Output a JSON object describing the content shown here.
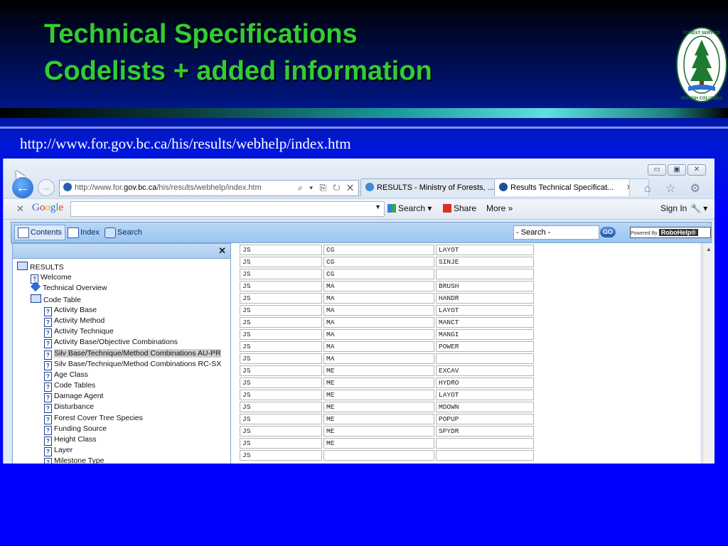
{
  "slide": {
    "title_line1": "Technical Specifications",
    "title_line2": "Codelists + added information",
    "url_caption": "http://www.for.gov.bc.ca/his/results/webhelp/index.htm",
    "logo_text_top": "FOREST SERVICE",
    "logo_text_bottom": "BRITISH COLUMBIA"
  },
  "browser": {
    "address_prefix": "http://www.for.",
    "address_domain": "gov.bc.ca",
    "address_suffix": "/his/results/webhelp/index.htm",
    "address_tools": "⌕ ▾ ⎘ ↻ ✕",
    "tabs": [
      {
        "label": "RESULTS - Ministry of Forests, ..."
      },
      {
        "label": "Results Technical Specificat...",
        "close": "✕"
      }
    ],
    "window_buttons": [
      "▭",
      "▣",
      "✕"
    ],
    "toolbar_icons": "⌂ ☆ ⚙",
    "back_glyph": "←",
    "forward_glyph": "→"
  },
  "google_bar": {
    "close": "✕",
    "logo": [
      "G",
      "o",
      "o",
      "g",
      "l",
      "e"
    ],
    "dropdown_glyph": "▼",
    "search_label": "Search ▾",
    "share_label": "Share",
    "more_label": "More »",
    "signin_label": "Sign In",
    "wrench_glyph": "🔧 ▾"
  },
  "robohelp": {
    "tab_contents": "Contents",
    "tab_index": "Index",
    "tab_search": "Search",
    "search_placeholder": "- Search -",
    "go_label": "GO",
    "powered_prefix": "Powered By",
    "powered_brand": "RoboHelp®",
    "toc_close": "✕",
    "toc": [
      {
        "label": "RESULTS",
        "type": "book",
        "indent": 0
      },
      {
        "label": "Welcome",
        "type": "topic",
        "indent": 1
      },
      {
        "label": "Technical Overview",
        "type": "diamond",
        "indent": 1
      },
      {
        "label": "Code Table",
        "type": "book",
        "indent": 1
      },
      {
        "label": "Activity Base",
        "type": "topic",
        "indent": 2
      },
      {
        "label": "Activity Method",
        "type": "topic",
        "indent": 2
      },
      {
        "label": "Activity Technique",
        "type": "topic",
        "indent": 2
      },
      {
        "label": "Activity Base/Objective Combinations",
        "type": "topic",
        "indent": 2
      },
      {
        "label": "Silv Base/Technique/Method Combinations AU-PR",
        "type": "topic",
        "indent": 2,
        "selected": true
      },
      {
        "label": "Silv Base/Technique/Method Combinations RC-SX",
        "type": "topic",
        "indent": 2
      },
      {
        "label": "Age Class",
        "type": "topic",
        "indent": 2
      },
      {
        "label": "Code Tables",
        "type": "topic",
        "indent": 2
      },
      {
        "label": "Damage Agent",
        "type": "topic",
        "indent": 2
      },
      {
        "label": "Disturbance",
        "type": "topic",
        "indent": 2
      },
      {
        "label": "Forest Cover Tree Species",
        "type": "topic",
        "indent": 2
      },
      {
        "label": "Funding Source",
        "type": "topic",
        "indent": 2
      },
      {
        "label": "Height Class",
        "type": "topic",
        "indent": 2
      },
      {
        "label": "Layer",
        "type": "topic",
        "indent": 2
      },
      {
        "label": "Milestone Type",
        "type": "topic",
        "indent": 2
      }
    ],
    "rows": [
      [
        "JS",
        "CG",
        "LAYOT"
      ],
      [
        "JS",
        "CG",
        "SINJE"
      ],
      [
        "JS",
        "CG",
        ""
      ],
      [
        "JS",
        "MA",
        "BRUSH"
      ],
      [
        "JS",
        "MA",
        "HANDR"
      ],
      [
        "JS",
        "MA",
        "LAYOT"
      ],
      [
        "JS",
        "MA",
        "MANCT"
      ],
      [
        "JS",
        "MA",
        "MANGI"
      ],
      [
        "JS",
        "MA",
        "POWER"
      ],
      [
        "JS",
        "MA",
        ""
      ],
      [
        "JS",
        "ME",
        "EXCAV"
      ],
      [
        "JS",
        "ME",
        "HYDRO"
      ],
      [
        "JS",
        "ME",
        "LAYOT"
      ],
      [
        "JS",
        "ME",
        "MDOWN"
      ],
      [
        "JS",
        "ME",
        "POPUP"
      ],
      [
        "JS",
        "ME",
        "SPYDR"
      ],
      [
        "JS",
        "ME",
        ""
      ],
      [
        "JS",
        "",
        ""
      ]
    ]
  },
  "colors": {
    "title_green": "#33cc33",
    "slide_blue": "#0000ff",
    "robohelp_blue": "#9cc6f0"
  }
}
